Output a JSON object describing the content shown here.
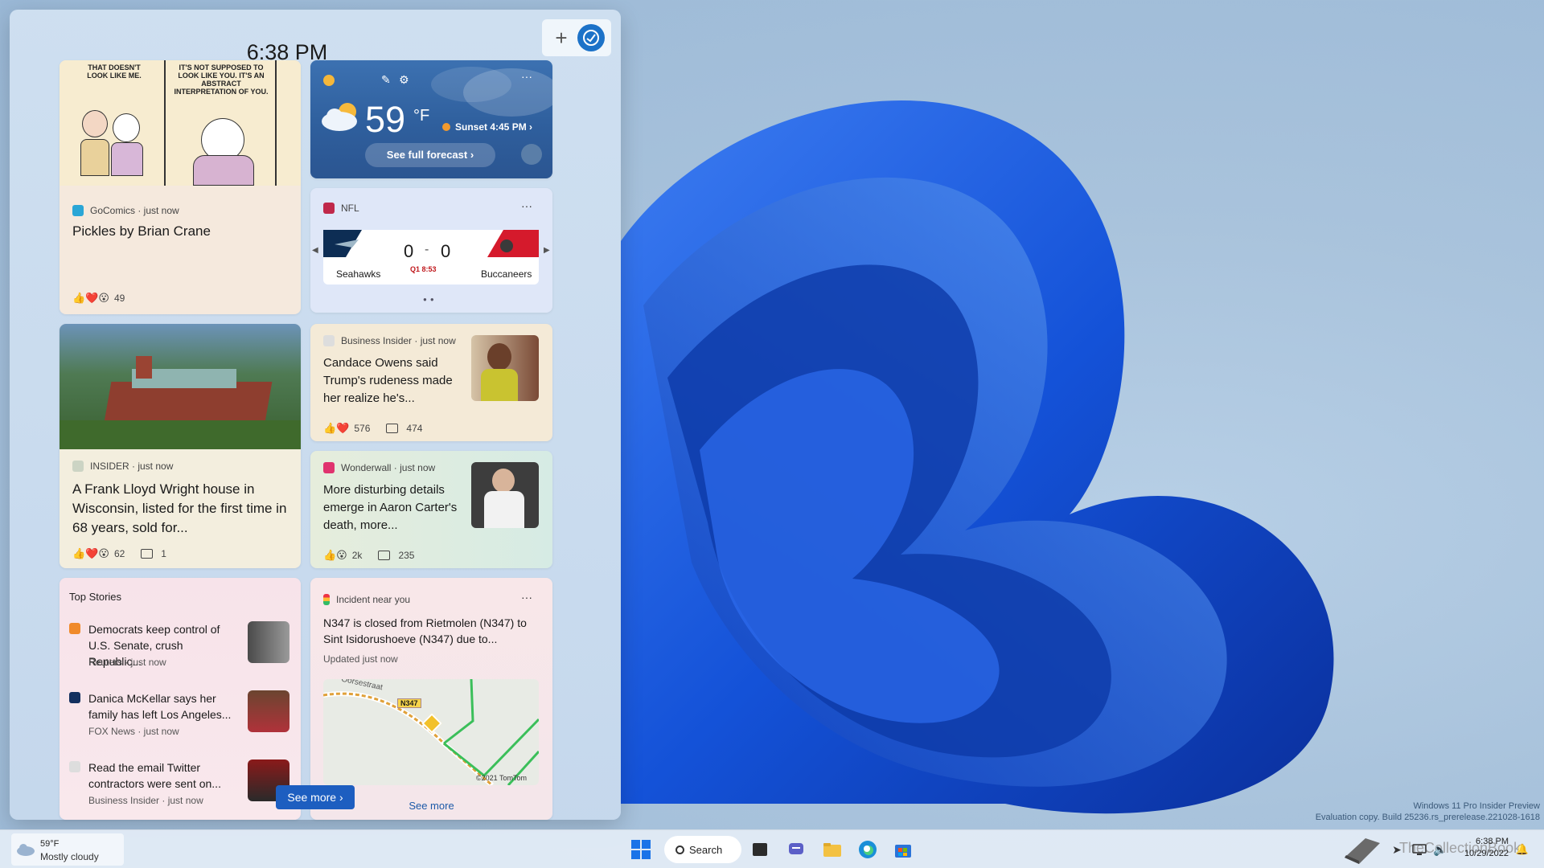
{
  "panel": {
    "time": "6:38 PM",
    "add_button": "+"
  },
  "comic": {
    "source": "GoComics · just now",
    "title": "Pickles by Brian Crane",
    "reactions": "49",
    "bubble1": "THAT DOESN'T LOOK LIKE ME.",
    "bubble2": "IT'S NOT SUPPOSED TO LOOK LIKE YOU. IT'S AN ABSTRACT INTERPRETATION OF YOU."
  },
  "weather": {
    "temp": "59",
    "unit": "°F",
    "sunset": "Sunset 4:45 PM",
    "forecast_button": "See full forecast",
    "more": "···"
  },
  "nfl": {
    "label": "NFL",
    "team_home": "Seahawks",
    "team_away": "Buccaneers",
    "score_home": "0",
    "score_away": "0",
    "score_sep": "-",
    "clock": "Q1 8:53",
    "more": "···"
  },
  "news": [
    {
      "source": "Business Insider · just now",
      "title": "Candace Owens said Trump's rudeness made her realize he's...",
      "likes": "576",
      "comments": "474"
    },
    {
      "source": "INSIDER · just now",
      "title": "A Frank Lloyd Wright house in Wisconsin, listed for the first time in 68 years, sold for...",
      "likes": "62",
      "comments": "1"
    },
    {
      "source": "Wonderwall · just now",
      "title": "More disturbing details emerge in Aaron Carter's death, more...",
      "likes": "2k",
      "comments": "235"
    }
  ],
  "top_stories": {
    "heading": "Top Stories",
    "items": [
      {
        "title": "Democrats keep control of U.S. Senate, crush Republic...",
        "meta": "Reuters · just now"
      },
      {
        "title": "Danica McKellar says her family has left Los Angeles...",
        "meta": "FOX News · just now"
      },
      {
        "title": "Read the email Twitter contractors were sent on...",
        "meta": "Business Insider · just now"
      }
    ],
    "see_more": "See more"
  },
  "incident": {
    "label": "Incident near you",
    "text": "N347 is closed from Rietmolen (N347) to Sint Isidorushoeve (N347) due to...",
    "updated": "Updated just now",
    "road": "N347",
    "street": "Oorsestraat",
    "credit": "©2021 TomTom",
    "see_more": "See more",
    "more": "···"
  },
  "watermark": {
    "line1": "Windows 11 Pro Insider Preview",
    "line2": "Evaluation copy. Build 25236.rs_prerelease.221028-1618"
  },
  "taskbar": {
    "weather_temp": "59°F",
    "weather_desc": "Mostly cloudy",
    "search": "Search",
    "time": "6:38 PM",
    "date": "10/29/2022",
    "overlay_text": "TheCollectionBook"
  },
  "colors": {
    "accent": "#1d5ec0",
    "weather_bg": "#3465a6",
    "bloom": "#1f5fe0"
  }
}
